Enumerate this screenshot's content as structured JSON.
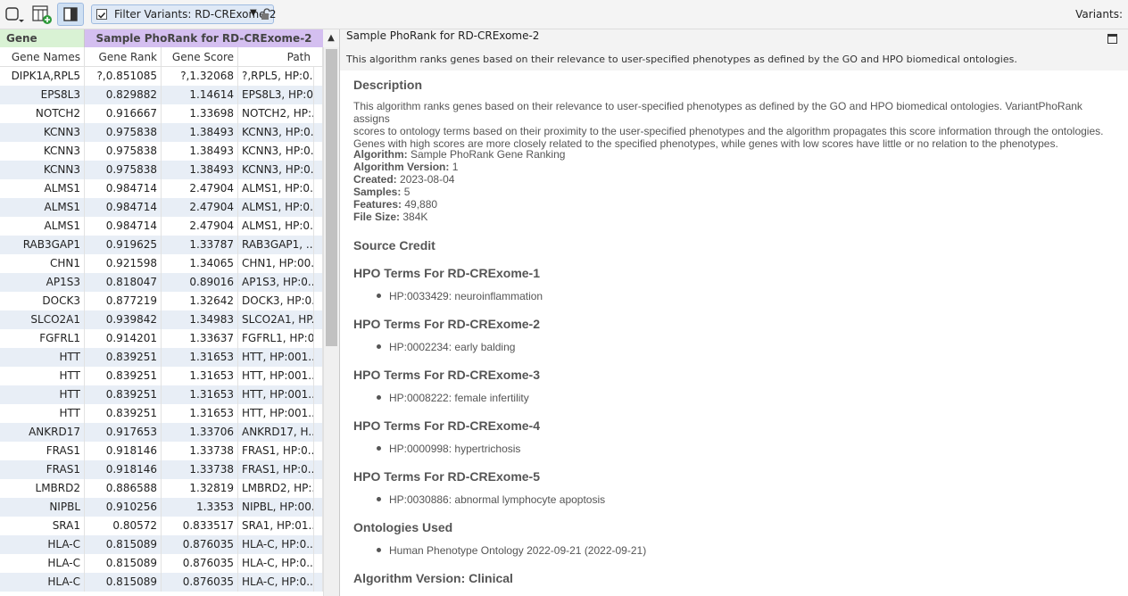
{
  "toolbar": {
    "filter_label": "Filter Variants: RD-CRExome-2",
    "variants_label": "Variants:"
  },
  "table": {
    "group_gene": "Gene",
    "group_phorank": "Sample PhoRank for RD-CRExome-2",
    "columns": [
      "Gene Names",
      "Gene Rank",
      "Gene Score",
      "Path"
    ],
    "rows": [
      [
        "DIPK1A,RPL5",
        "?,0.851085",
        "?,1.32068",
        "?,RPL5, HP:0..."
      ],
      [
        "EPS8L3",
        "0.829882",
        "1.14614",
        "EPS8L3, HP:0..."
      ],
      [
        "NOTCH2",
        "0.916667",
        "1.33698",
        "NOTCH2, HP:..."
      ],
      [
        "KCNN3",
        "0.975838",
        "1.38493",
        "KCNN3, HP:0..."
      ],
      [
        "KCNN3",
        "0.975838",
        "1.38493",
        "KCNN3, HP:0..."
      ],
      [
        "KCNN3",
        "0.975838",
        "1.38493",
        "KCNN3, HP:0..."
      ],
      [
        "ALMS1",
        "0.984714",
        "2.47904",
        "ALMS1, HP:0..."
      ],
      [
        "ALMS1",
        "0.984714",
        "2.47904",
        "ALMS1, HP:0..."
      ],
      [
        "ALMS1",
        "0.984714",
        "2.47904",
        "ALMS1, HP:0..."
      ],
      [
        "RAB3GAP1",
        "0.919625",
        "1.33787",
        "RAB3GAP1, ..."
      ],
      [
        "CHN1",
        "0.921598",
        "1.34065",
        "CHN1, HP:00..."
      ],
      [
        "AP1S3",
        "0.818047",
        "0.89016",
        "AP1S3, HP:0..."
      ],
      [
        "DOCK3",
        "0.877219",
        "1.32642",
        "DOCK3, HP:0..."
      ],
      [
        "SLCO2A1",
        "0.939842",
        "1.34983",
        "SLCO2A1, HP..."
      ],
      [
        "FGFRL1",
        "0.914201",
        "1.33637",
        "FGFRL1, HP:0..."
      ],
      [
        "HTT",
        "0.839251",
        "1.31653",
        "HTT, HP:001..."
      ],
      [
        "HTT",
        "0.839251",
        "1.31653",
        "HTT, HP:001..."
      ],
      [
        "HTT",
        "0.839251",
        "1.31653",
        "HTT, HP:001..."
      ],
      [
        "HTT",
        "0.839251",
        "1.31653",
        "HTT, HP:001..."
      ],
      [
        "ANKRD17",
        "0.917653",
        "1.33706",
        "ANKRD17, H..."
      ],
      [
        "FRAS1",
        "0.918146",
        "1.33738",
        "FRAS1, HP:0..."
      ],
      [
        "FRAS1",
        "0.918146",
        "1.33738",
        "FRAS1, HP:0..."
      ],
      [
        "LMBRD2",
        "0.886588",
        "1.32819",
        "LMBRD2, HP:..."
      ],
      [
        "NIPBL",
        "0.910256",
        "1.3353",
        "NIPBL, HP:00..."
      ],
      [
        "SRA1",
        "0.80572",
        "0.833517",
        "SRA1, HP:01..."
      ],
      [
        "HLA-C",
        "0.815089",
        "0.876035",
        "HLA-C, HP:0..."
      ],
      [
        "HLA-C",
        "0.815089",
        "0.876035",
        "HLA-C, HP:0..."
      ],
      [
        "HLA-C",
        "0.815089",
        "0.876035",
        "HLA-C, HP:0..."
      ]
    ]
  },
  "detail": {
    "title": "Sample PhoRank for RD-CRExome-2",
    "subtitle": "This algorithm ranks genes based on their relevance to user-specified phenotypes as defined by the GO and HPO biomedical ontologies.",
    "description_heading": "Description",
    "description_lines": [
      "This algorithm ranks genes based on their relevance to user-specified phenotypes as defined by the GO and HPO biomedical ontologies. VariantPhoRank assigns",
      "scores to ontology terms based on their proximity to the user-specified phenotypes and the algorithm propagates this score information through the ontologies.",
      "Genes with high scores are more closely related to the specified phenotypes, while genes with low scores have little or no relation to the phenotypes."
    ],
    "meta": [
      {
        "key": "Algorithm:",
        "value": "Sample PhoRank Gene Ranking"
      },
      {
        "key": "Algorithm Version:",
        "value": "1"
      },
      {
        "key": "Created:",
        "value": "2023-08-04"
      },
      {
        "key": "Samples:",
        "value": "5"
      },
      {
        "key": "Features:",
        "value": "49,880"
      },
      {
        "key": "File Size:",
        "value": "384K"
      }
    ],
    "source_credit_heading": "Source Credit",
    "hpo_sections": [
      {
        "heading": "HPO Terms For RD-CRExome-1",
        "term": "HP:0033429: neuroinflammation"
      },
      {
        "heading": "HPO Terms For RD-CRExome-2",
        "term": "HP:0002234: early balding"
      },
      {
        "heading": "HPO Terms For RD-CRExome-3",
        "term": "HP:0008222: female infertility"
      },
      {
        "heading": "HPO Terms For RD-CRExome-4",
        "term": "HP:0000998: hypertrichosis"
      },
      {
        "heading": "HPO Terms For RD-CRExome-5",
        "term": "HP:0030886: abnormal lymphocyte apoptosis"
      }
    ],
    "ontologies_heading": "Ontologies Used",
    "ontologies_item": "Human Phenotype Ontology 2022-09-21 (2022-09-21)",
    "version_heading": "Algorithm Version: Clinical"
  }
}
